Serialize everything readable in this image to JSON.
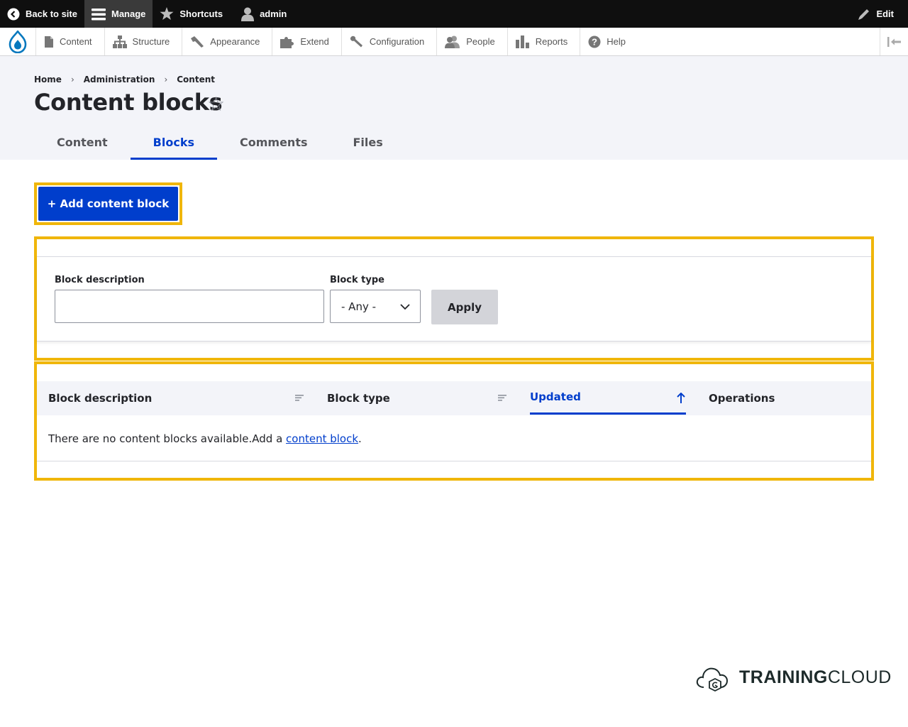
{
  "toolbar": {
    "back_to_site": "Back to site",
    "manage": "Manage",
    "shortcuts": "Shortcuts",
    "user": "admin",
    "edit": "Edit"
  },
  "tray": {
    "items": [
      {
        "label": "Content",
        "icon": "file-icon"
      },
      {
        "label": "Structure",
        "icon": "sitemap-icon"
      },
      {
        "label": "Appearance",
        "icon": "paintbrush-icon"
      },
      {
        "label": "Extend",
        "icon": "puzzle-icon"
      },
      {
        "label": "Configuration",
        "icon": "wrench-icon"
      },
      {
        "label": "People",
        "icon": "people-icon"
      },
      {
        "label": "Reports",
        "icon": "bar-chart-icon"
      },
      {
        "label": "Help",
        "icon": "help-icon"
      }
    ]
  },
  "breadcrumb": [
    "Home",
    "Administration",
    "Content"
  ],
  "page": {
    "title": "Content blocks",
    "star_glyph": "☆"
  },
  "tabs": [
    {
      "label": "Content",
      "active": false
    },
    {
      "label": "Blocks",
      "active": true
    },
    {
      "label": "Comments",
      "active": false
    },
    {
      "label": "Files",
      "active": false
    }
  ],
  "actions": {
    "add_label": "+ Add content block"
  },
  "filters": {
    "description_label": "Block description",
    "description_value": "",
    "type_label": "Block type",
    "type_value": "- Any -",
    "apply_label": "Apply"
  },
  "table": {
    "columns": [
      {
        "label": "Block description",
        "sortable": true,
        "active": false
      },
      {
        "label": "Block type",
        "sortable": true,
        "active": false
      },
      {
        "label": "Updated",
        "sortable": true,
        "active": true,
        "direction": "ascending"
      },
      {
        "label": "Operations",
        "sortable": false,
        "active": false
      }
    ],
    "empty_text": "There are no content blocks available.Add a ",
    "empty_link": "content block",
    "empty_end": "."
  },
  "brand": {
    "bold": "TRAINING",
    "light": "CLOUD"
  },
  "colors": {
    "accent": "#003ecc",
    "highlight": "#f0b60a",
    "toolbar": "#0f0f0f",
    "header_bg": "#f3f4f9"
  }
}
